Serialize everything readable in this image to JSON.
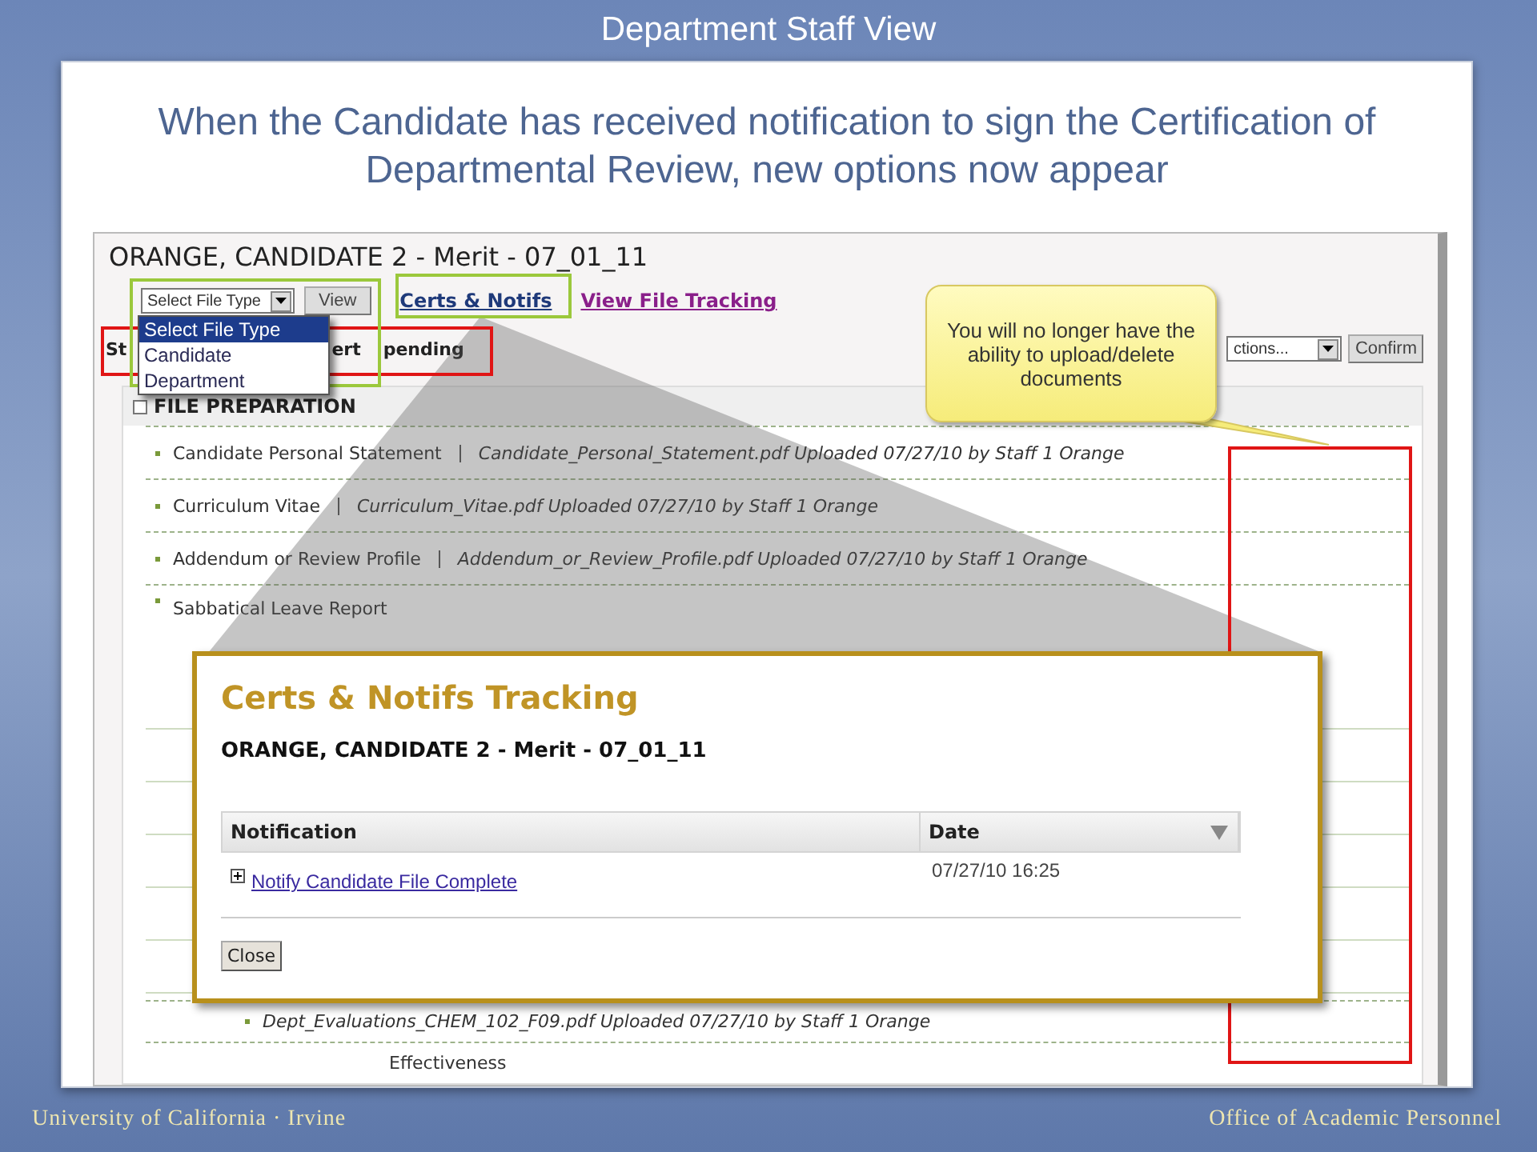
{
  "slide_title": "Department Staff View",
  "heading": "When the Candidate has received notification to sign the Certification of Departmental Review, new options now appear",
  "screen": {
    "candidate_title": "ORANGE, CANDIDATE 2 - Merit - 07_01_11",
    "file_type_select": {
      "value": "Select File Type"
    },
    "view_button": "View",
    "links": [
      {
        "label": "Certs & Notifs",
        "visited": false
      },
      {
        "label": "View File Tracking",
        "visited": true
      }
    ],
    "status_fragments": [
      "St",
      "ert",
      "pending"
    ],
    "actions_select": {
      "value": "ctions..."
    },
    "confirm_button": "Confirm",
    "section_title": "FILE PREPARATION",
    "rows": [
      {
        "label": "Candidate Personal Statement",
        "file": "Candidate_Personal_Statement.pdf Uploaded 07/27/10 by Staff 1 Orange"
      },
      {
        "label": "Curriculum Vitae",
        "file": "Curriculum_Vitae.pdf Uploaded 07/27/10 by Staff 1 Orange"
      },
      {
        "label": "Addendum or Review Profile",
        "file": "Addendum_or_Review_Profile.pdf Uploaded 07/27/10 by Staff 1 Orange"
      },
      {
        "label": "Sabbatical Leave Report"
      }
    ],
    "lower_rows": [
      {
        "file": "Dept_Evaluations_CHEM_102_F09.pdf Uploaded 07/27/10 by Staff 1 Orange"
      },
      {
        "label": "Effectiveness"
      }
    ]
  },
  "dropdown_options": [
    {
      "label": "Select File Type",
      "selected": true
    },
    {
      "label": "Candidate",
      "selected": false
    },
    {
      "label": "Department",
      "selected": false
    }
  ],
  "callout": "You will no longer have the ability to upload/delete documents",
  "popup": {
    "title": "Certs & Notifs Tracking",
    "subtitle": "ORANGE, CANDIDATE 2 - Merit - 07_01_11",
    "columns": [
      "Notification",
      "Date"
    ],
    "rows": [
      {
        "notification": "Notify Candidate File Complete",
        "date": "07/27/10 16:25",
        "expanded": false
      }
    ],
    "close_button": "Close"
  },
  "footer": {
    "left": "University of California · Irvine",
    "right": "Office of Academic Personnel"
  }
}
